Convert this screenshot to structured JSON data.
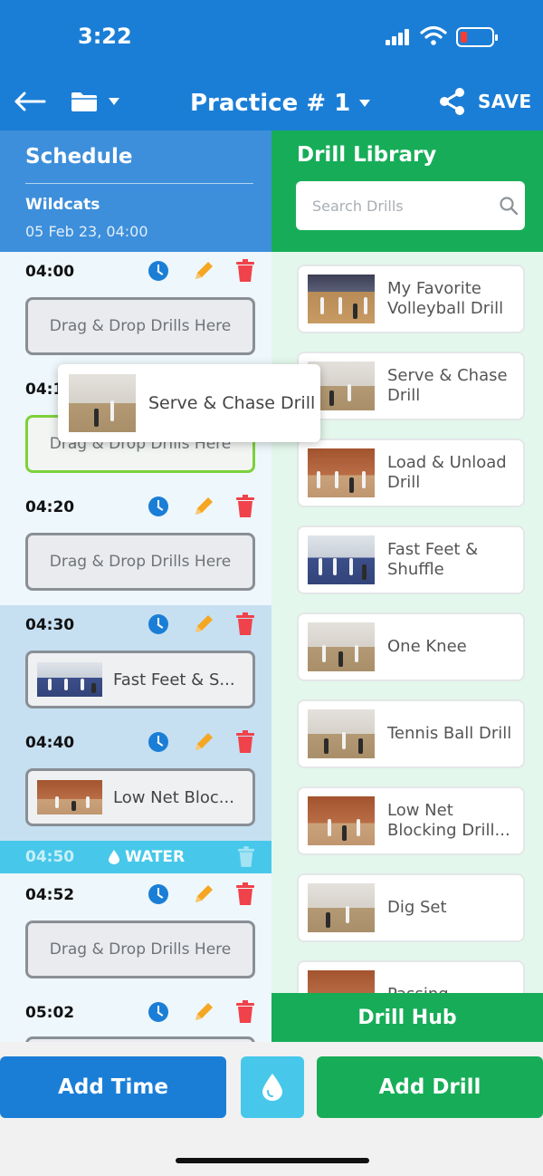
{
  "status_bar": {
    "time": "3:22"
  },
  "nav": {
    "title": "Practice # 1",
    "save_label": "SAVE"
  },
  "schedule": {
    "title": "Schedule",
    "team": "Wildcats",
    "date": "05 Feb 23, 04:00",
    "slots": [
      {
        "time": "04:00",
        "dropzone": "Drag & Drop Drills Here"
      },
      {
        "time": "04:1",
        "dropzone": "Drag & Drop Drills Here"
      },
      {
        "time": "04:20",
        "dropzone": "Drag & Drop Drills Here"
      },
      {
        "time": "04:30",
        "drill": "Fast Feet & S..."
      },
      {
        "time": "04:40",
        "drill": "Low Net Bloc..."
      },
      {
        "time": "04:52",
        "dropzone": "Drag & Drop Drills Here"
      },
      {
        "time": "05:02"
      }
    ],
    "water": {
      "time": "04:50",
      "label": "WATER"
    }
  },
  "dragging": {
    "label": "Serve & Chase Drill"
  },
  "library": {
    "title": "Drill Library",
    "search_placeholder": "Search Drills",
    "items": [
      {
        "label": "My Favorite Volleyball Drill"
      },
      {
        "label": "Serve & Chase Drill"
      },
      {
        "label": "Load & Unload Drill"
      },
      {
        "label": "Fast Feet & Shuffle"
      },
      {
        "label": "One Knee"
      },
      {
        "label": "Tennis Ball Drill"
      },
      {
        "label": "Low Net Blocking Drill..."
      },
      {
        "label": "Dig Set"
      },
      {
        "label": "Passing,"
      }
    ],
    "hub_label": "Drill Hub"
  },
  "bottom": {
    "add_time_label": "Add Time",
    "add_drill_label": "Add Drill"
  },
  "colors": {
    "primary_blue": "#1b7ed6",
    "green": "#17ad58",
    "water": "#47c8ea",
    "delete_red": "#f0424a",
    "edit_orange": "#f5a623"
  }
}
